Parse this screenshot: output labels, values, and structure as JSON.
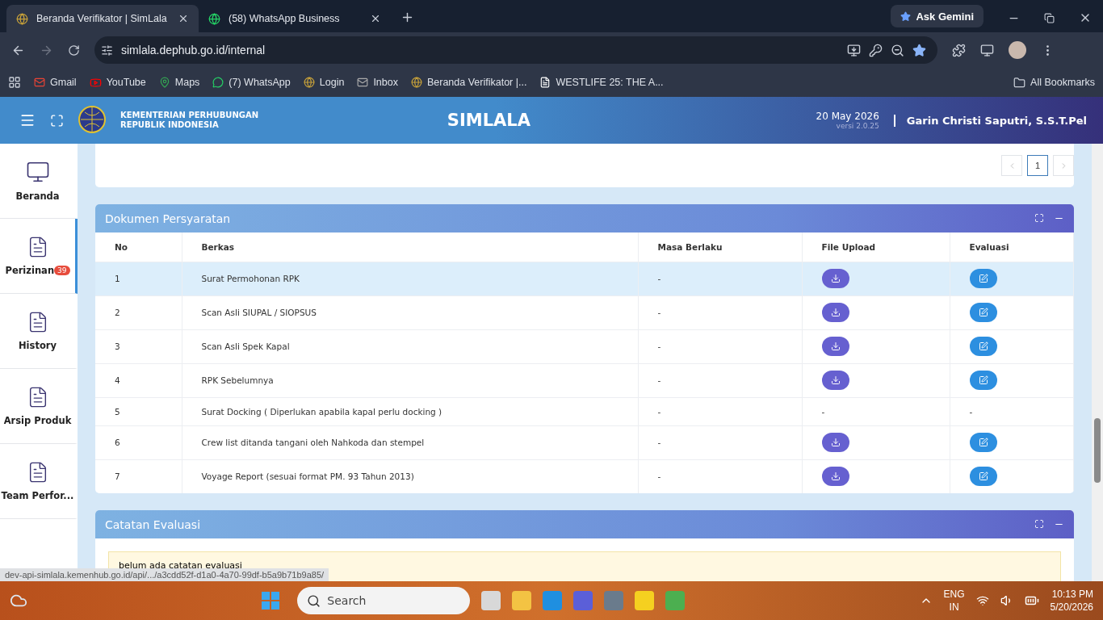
{
  "browser": {
    "tabs": [
      {
        "title": "Beranda Verifikator | SimLala",
        "selected": true
      },
      {
        "title": "(58) WhatsApp Business",
        "selected": false
      }
    ],
    "ask_button": "Ask Gemini",
    "address": "simlala.dephub.go.id/internal",
    "bookmarks": [
      "Gmail",
      "YouTube",
      "Maps",
      "(7) WhatsApp",
      "Login",
      "Inbox",
      "Beranda Verifikator |...",
      "WESTLIFE 25: THE A..."
    ],
    "all_bookmarks": "All Bookmarks",
    "status_url": "dev-api-simlala.kemenhub.go.id/api/.../a3cdd52f-d1a0-4a70-99df-b5a9b71b9a85/"
  },
  "header": {
    "org_line1": "KEMENTERIAN PERHUBUNGAN",
    "org_line2": "REPUBLIK INDONESIA",
    "app_title": "SIMLALA",
    "date": "20 May 2026",
    "version": "versi 2.0.25",
    "user": "Garin Christi Saputri, S.S.T.Pel"
  },
  "sidebar": {
    "items": [
      {
        "label": "Beranda",
        "selected": false,
        "kind": "monitor"
      },
      {
        "label": "Perizinan",
        "selected": true,
        "kind": "doc",
        "badge": "39"
      },
      {
        "label": "History",
        "selected": false,
        "kind": "doc"
      },
      {
        "label": "Arsip Produk",
        "selected": false,
        "kind": "doc"
      },
      {
        "label": "Team Perfor...",
        "selected": false,
        "kind": "doc"
      }
    ]
  },
  "pagination": {
    "pages": [
      {
        "label": "1",
        "selected": true
      }
    ]
  },
  "documents": {
    "title": "Dokumen Persyaratan",
    "columns": [
      "No",
      "Berkas",
      "Masa Berlaku",
      "File Upload",
      "Evaluasi"
    ],
    "rows": [
      {
        "no": "1",
        "berkas": "Surat Permohonan RPK",
        "masa": "-",
        "kind": "file",
        "selected": true
      },
      {
        "no": "2",
        "berkas": "Scan Asli SIUPAL / SIOPSUS",
        "masa": "-",
        "kind": "file",
        "selected": false
      },
      {
        "no": "3",
        "berkas": "Scan Asli Spek Kapal",
        "masa": "-",
        "kind": "file",
        "selected": false
      },
      {
        "no": "4",
        "berkas": "RPK Sebelumnya",
        "masa": "-",
        "kind": "file",
        "selected": false
      },
      {
        "no": "5",
        "berkas": "Surat Docking ( Diperlukan apabila kapal perlu docking )",
        "masa": "-",
        "kind": "empty",
        "file_upload": "-",
        "evaluasi": "-",
        "selected": false
      },
      {
        "no": "6",
        "berkas": "Crew list ditanda tangani oleh Nahkoda dan stempel",
        "masa": "-",
        "kind": "file",
        "selected": false
      },
      {
        "no": "7",
        "berkas": "Voyage Report (sesuai format PM. 93 Tahun 2013)",
        "masa": "-",
        "kind": "file",
        "selected": false
      }
    ]
  },
  "notes": {
    "title": "Catatan Evaluasi",
    "message": "belum ada catatan evaluasi"
  },
  "taskbar": {
    "search": "Search",
    "lang1": "ENG",
    "lang2": "IN",
    "time": "10:13 PM",
    "date": "5/20/2026"
  }
}
